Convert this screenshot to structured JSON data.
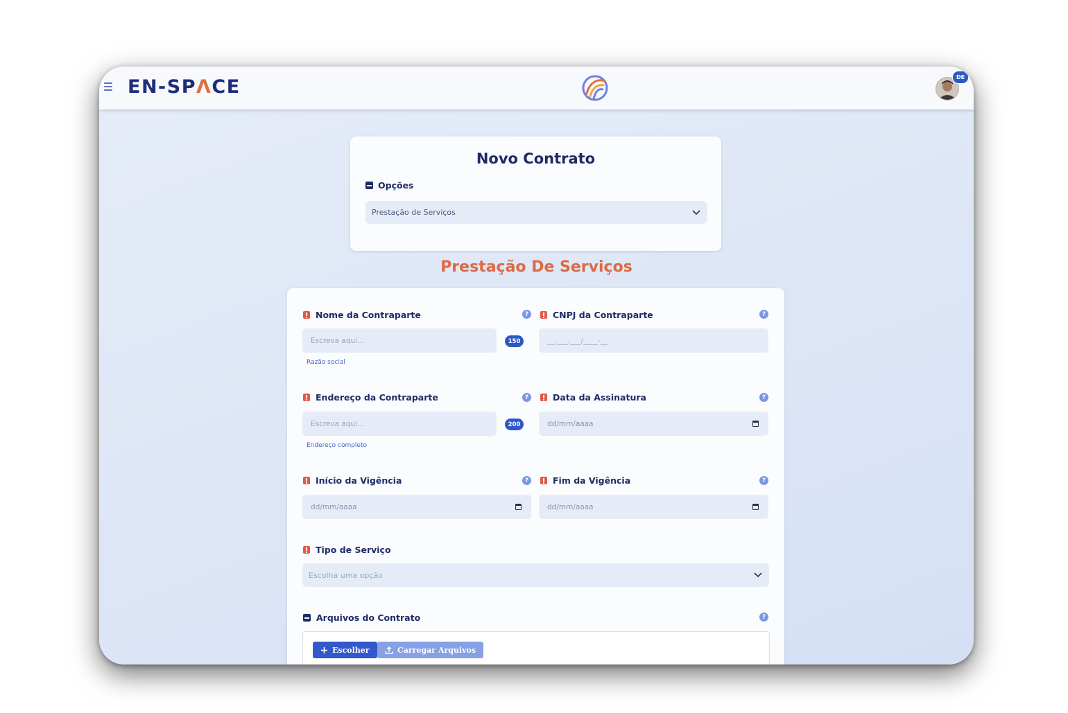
{
  "header": {
    "brand_prefix": "EN",
    "brand_dash": "-",
    "brand_suffix_1": "SP",
    "brand_accent_letter": "Λ",
    "brand_suffix_2": "CE",
    "avatar_badge": "DE"
  },
  "options_card": {
    "title": "Novo Contrato",
    "section_label": "Opções",
    "selected_option": "Prestação de Serviços"
  },
  "form": {
    "title": "Prestação De Serviços",
    "fields": {
      "nome": {
        "label": "Nome da Contraparte",
        "placeholder": "Escreva aqui...",
        "counter": "150",
        "hint": "Razão social"
      },
      "cnpj": {
        "label": "CNPJ da Contraparte",
        "placeholder": "__.___.___/____-__"
      },
      "endereco": {
        "label": "Endereço da Contraparte",
        "placeholder": "Escreva aqui...",
        "counter": "200",
        "hint": "Endereço completo"
      },
      "data_assinatura": {
        "label": "Data da Assinatura",
        "placeholder": "dd/mm/aaaa"
      },
      "inicio_vigencia": {
        "label": "Início da Vigência",
        "placeholder": "dd/mm/aaaa"
      },
      "fim_vigencia": {
        "label": "Fim da Vigência",
        "placeholder": "dd/mm/aaaa"
      },
      "tipo_servico": {
        "label": "Tipo de Serviço",
        "placeholder": "Escolha uma opção"
      }
    },
    "files": {
      "label": "Arquivos do Contrato",
      "choose_button": "Escolher",
      "upload_button": "Carregar Arquivos"
    },
    "help_glyph": "?"
  },
  "colors": {
    "brand_navy": "#1e2d7a",
    "brand_orange": "#e0703c",
    "section_title": "#dd6a45",
    "primary_blue": "#3358cb",
    "required_red": "#e05a4a"
  }
}
